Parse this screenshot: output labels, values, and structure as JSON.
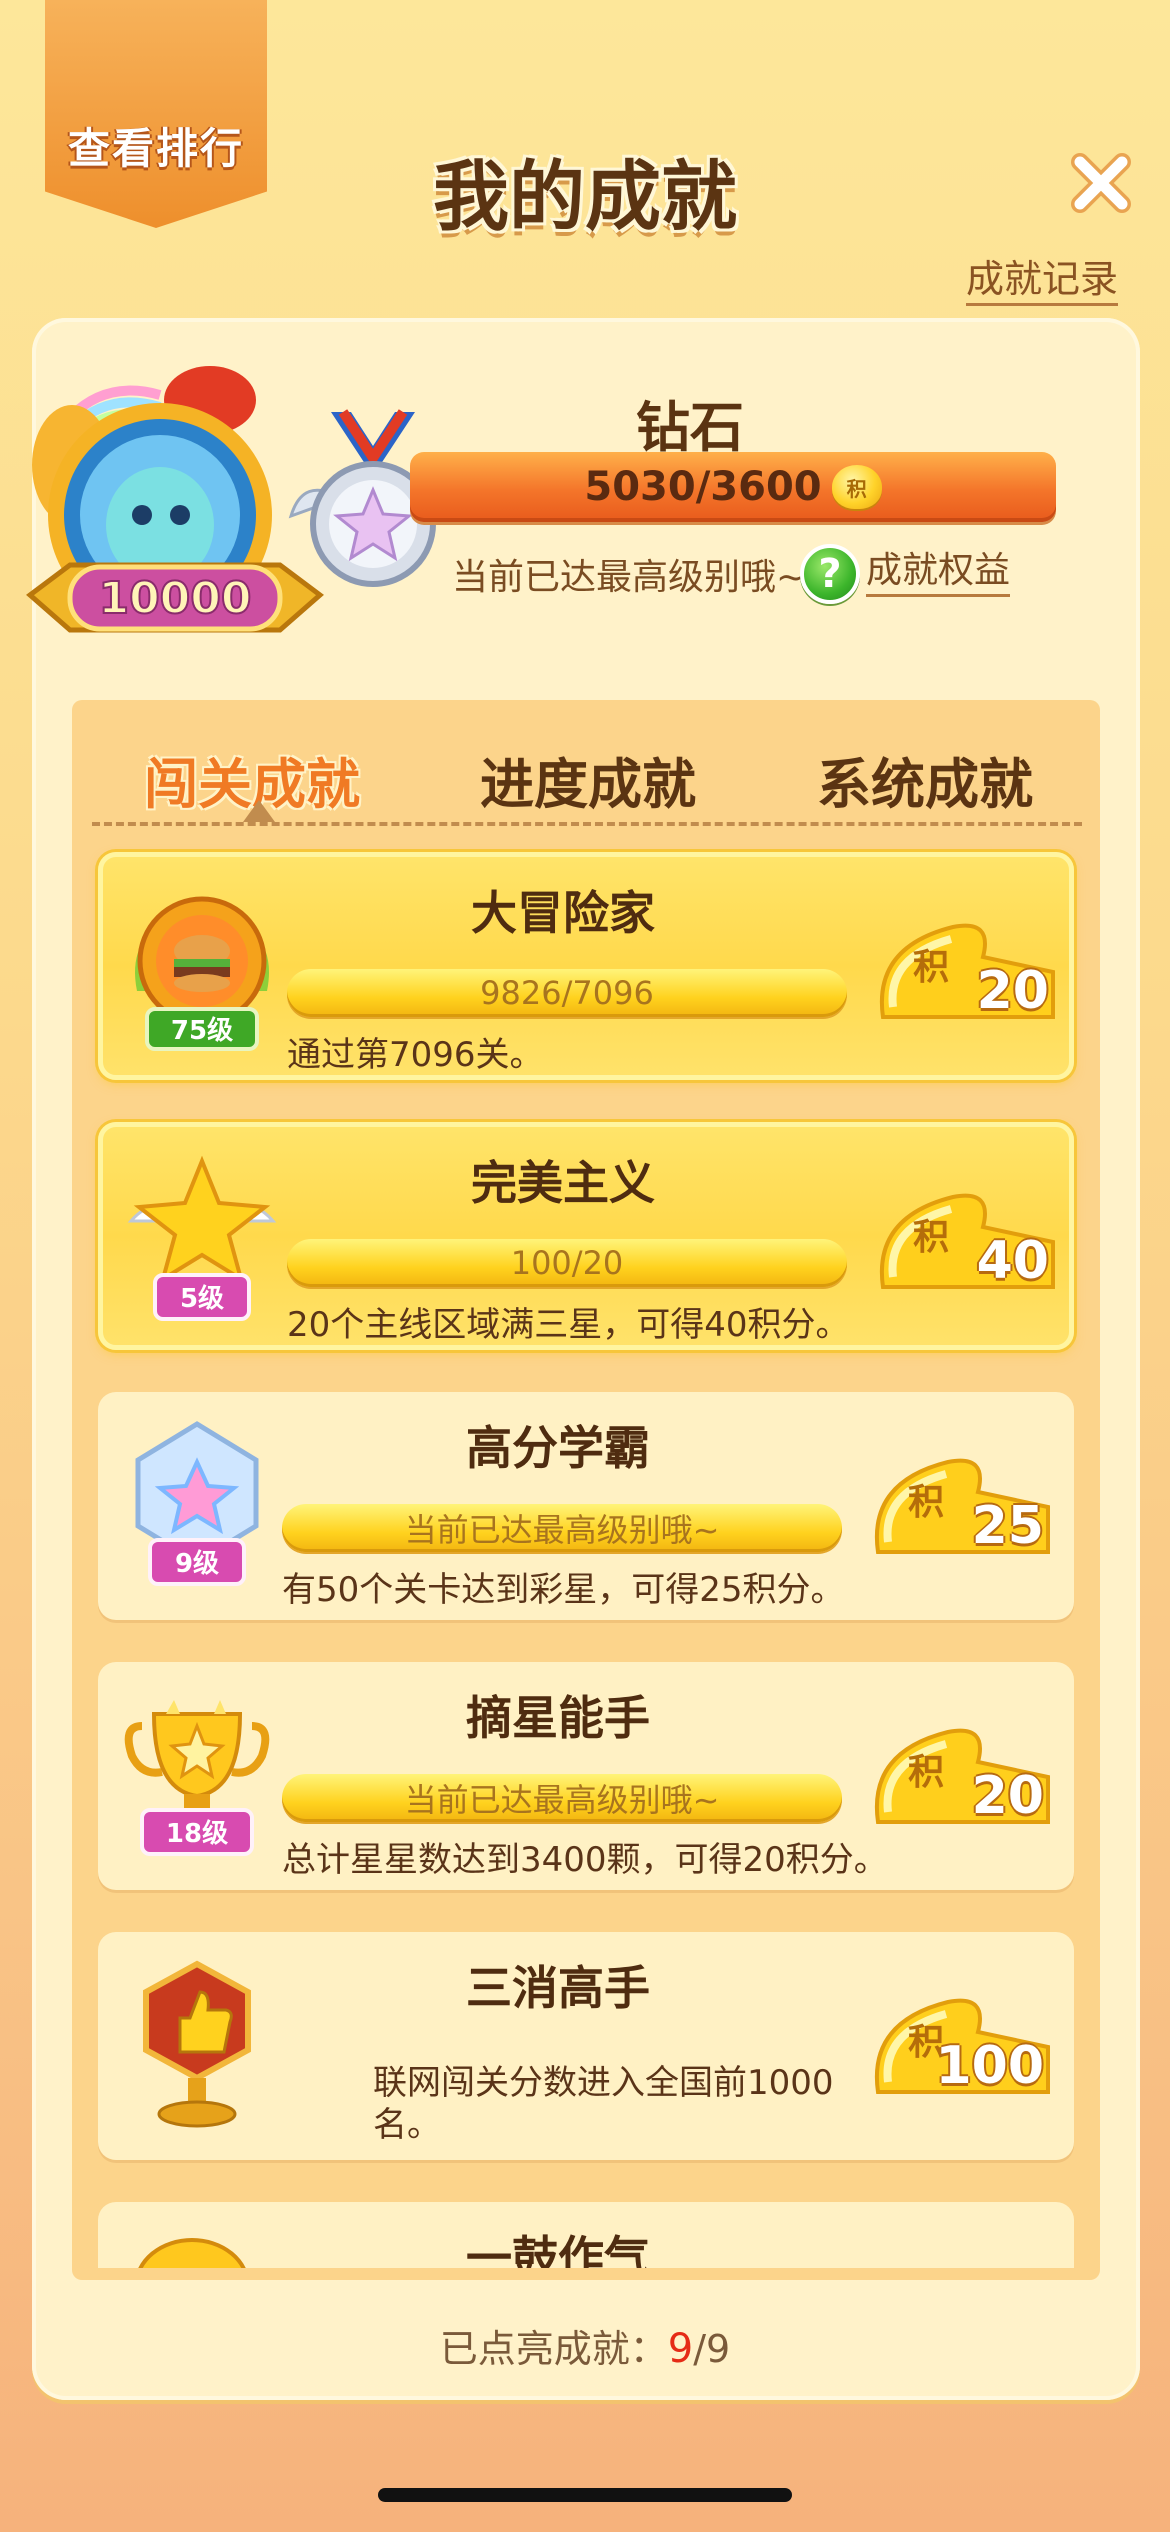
{
  "header": {
    "rank_button": "查看排行",
    "title": "我的成就",
    "record_link": "成就记录"
  },
  "level": {
    "score_badge": "10000",
    "name": "钻石",
    "progress_text": "5030/3600",
    "progress_fraction": 1.0,
    "coin_label": "积",
    "hint": "当前已达最高级别哦~",
    "help_symbol": "?",
    "rights_link": "成就权益"
  },
  "tabs": [
    {
      "label": "闯关成就",
      "active": true
    },
    {
      "label": "进度成就",
      "active": false
    },
    {
      "label": "系统成就",
      "active": false
    }
  ],
  "achievements": [
    {
      "title": "大冒险家",
      "progress": "9826/7096",
      "desc": "通过第7096关。",
      "badge_label": "75级",
      "reward_label": "积",
      "reward": "20",
      "icon": "burger-trophy-icon",
      "highlight": true
    },
    {
      "title": "完美主义",
      "progress": "100/20",
      "desc": "20个主线区域满三星，可得40积分。",
      "badge_label": "5级",
      "reward_label": "积",
      "reward": "40",
      "icon": "winged-star-icon",
      "highlight": true
    },
    {
      "title": "高分学霸",
      "progress": "当前已达最高级别哦~",
      "desc": "有50个关卡达到彩星，可得25积分。",
      "badge_label": "9级",
      "reward_label": "积",
      "reward": "25",
      "icon": "rainbow-star-gem-icon",
      "highlight": false
    },
    {
      "title": "摘星能手",
      "progress": "当前已达最高级别哦~",
      "desc": "总计星星数达到3400颗，可得20积分。",
      "badge_label": "18级",
      "reward_label": "积",
      "reward": "20",
      "icon": "star-cup-icon",
      "highlight": false
    },
    {
      "title": "三消高手",
      "desc": "联网闯关分数进入全国前1000名。",
      "reward_label": "积",
      "reward": "100",
      "icon": "thumbs-up-trophy-icon",
      "highlight": false
    },
    {
      "title": "一鼓作气",
      "icon": "partial-coin-icon",
      "highlight": false
    }
  ],
  "footer": {
    "label": "已点亮成就：",
    "lit": "9",
    "total": "/9"
  },
  "colors": {
    "accent_orange": "#f07a24",
    "progress_yellow": "#ffd21e",
    "background": "#fde79a",
    "count_red": "#e52b16"
  }
}
